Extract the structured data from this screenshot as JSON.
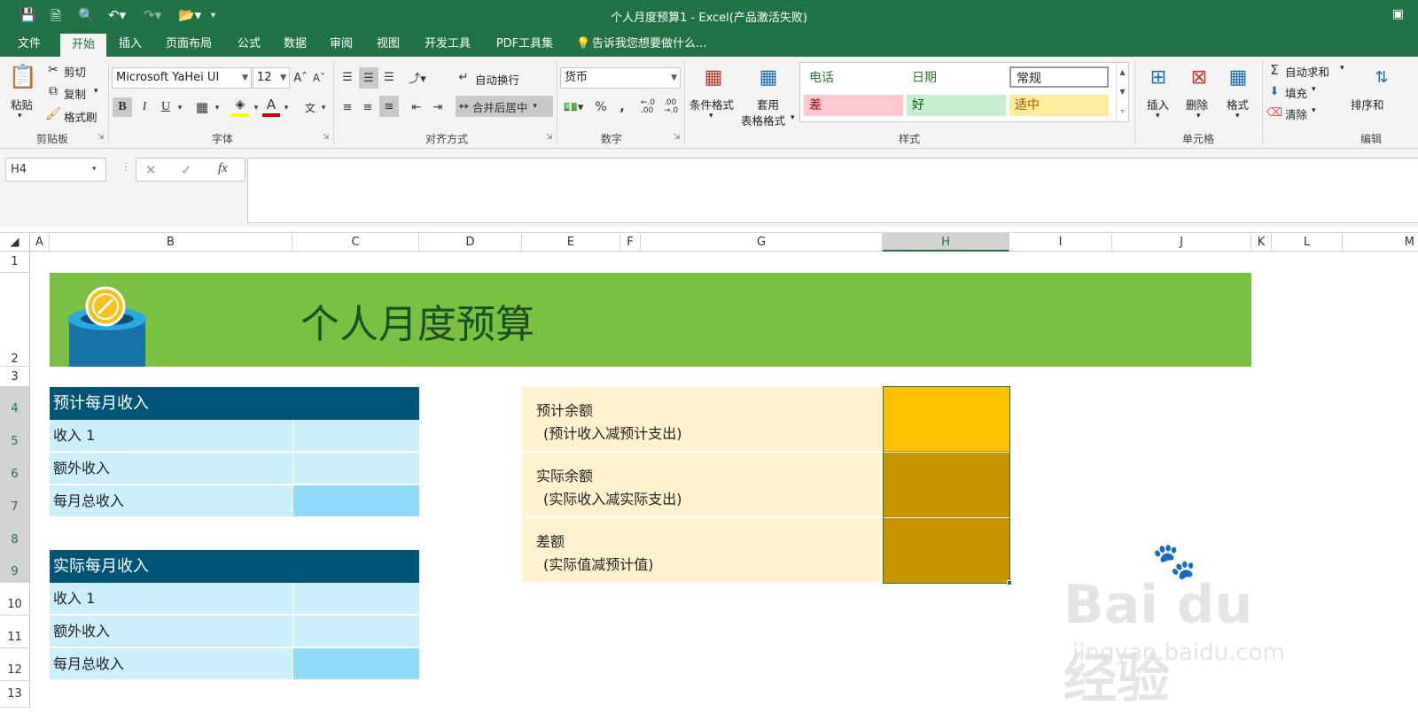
{
  "window": {
    "title": "个人月度预算1 - Excel(产品激活失败)"
  },
  "tabs": [
    "文件",
    "开始",
    "插入",
    "页面布局",
    "公式",
    "数据",
    "审阅",
    "视图",
    "开发工具",
    "PDF工具集"
  ],
  "tell_me": "告诉我您想要做什么...",
  "ribbon": {
    "clipboard": {
      "paste": "粘贴",
      "cut": "剪切",
      "copy": "复制",
      "format_painter": "格式刷",
      "label": "剪贴板"
    },
    "font": {
      "name": "Microsoft YaHei UI",
      "size": "12",
      "bold": "B",
      "italic": "I",
      "underline": "U",
      "label": "字体"
    },
    "alignment": {
      "wrap": "自动换行",
      "merge": "合并后居中",
      "label": "对齐方式"
    },
    "number": {
      "format": "货币",
      "label": "数字"
    },
    "styles": {
      "conditional": "条件格式",
      "table_format_1": "套用",
      "table_format_2": "表格格式",
      "cells": [
        "电话",
        "日期",
        "常规",
        "差",
        "好",
        "适中"
      ],
      "label": "样式"
    },
    "cells": {
      "insert": "插入",
      "delete": "删除",
      "format": "格式",
      "label": "单元格"
    },
    "editing": {
      "autosum": "自动求和",
      "fill": "填充",
      "clear": "清除",
      "sort": "排序和",
      "label": "编辑"
    }
  },
  "name_box": "H4",
  "columns": [
    "A",
    "B",
    "C",
    "D",
    "E",
    "F",
    "G",
    "H",
    "I",
    "J",
    "K",
    "L",
    "M"
  ],
  "rows": [
    "1",
    "2",
    "3",
    "4",
    "5",
    "6",
    "7",
    "8",
    "9",
    "10",
    "11",
    "12",
    "13"
  ],
  "sheet": {
    "title": "个人月度预算",
    "planned_income": {
      "header": "预计每月收入",
      "rows": [
        "收入 1",
        "额外收入",
        "每月总收入"
      ]
    },
    "actual_income": {
      "header": "实际每月收入",
      "rows": [
        "收入 1",
        "额外收入",
        "每月总收入"
      ]
    },
    "summary": [
      {
        "line1": "预计余额",
        "line2": "(预计收入减预计支出)",
        "color": "#ffc000"
      },
      {
        "line1": "实际余额",
        "line2": "(实际收入减实际支出)",
        "color": "#c89400"
      },
      {
        "line1": "差额",
        "line2": "(实际值减预计值)",
        "color": "#c89400"
      }
    ]
  },
  "colors": {
    "excel_green": "#217346",
    "banner": "#7ac143",
    "block_header": "#005577",
    "block_row": "#cceffc",
    "block_total": "#8edcfa",
    "summary_bg": "#fff2cc"
  },
  "watermark": {
    "brand": "Bai du 经验",
    "url": "jingyan.baidu.com"
  }
}
